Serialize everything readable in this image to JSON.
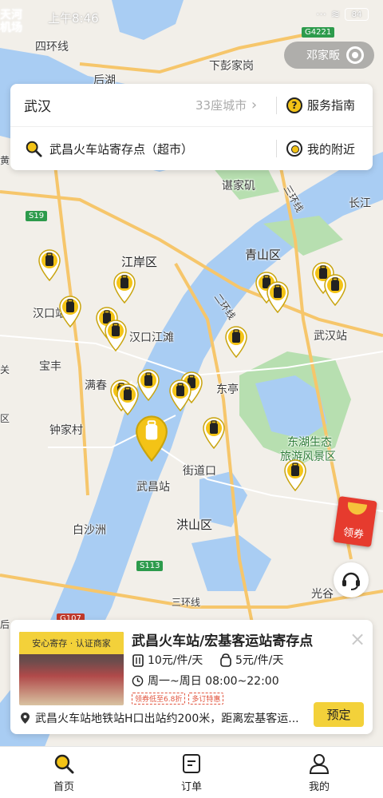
{
  "status_bar": {
    "time": "上午8:46",
    "battery": "84",
    "signal": "⋯",
    "wifi": "≋"
  },
  "map_overlay": {
    "user_chip_label": "邓家畈"
  },
  "search_card": {
    "city": "武汉",
    "city_count": "33座城市",
    "guide_label": "服务指南",
    "search_text": "武昌火车站寄存点（超市）",
    "nearby_label": "我的附近"
  },
  "map_labels": {
    "tianhe": "天河",
    "jichang": "机场",
    "sihuanxian": "四环线",
    "houhu": "后湖",
    "xiapeng": "下彭家岗",
    "xieji": "谌家矶",
    "sanhuanxian": "三环线",
    "changjiang": "长江",
    "jianganqu": "江岸区",
    "qingshanqu": "青山区",
    "hankouzhan": "汉口站",
    "hankoujiangtan": "汉口江滩",
    "erhuanxian": "二环线",
    "wuhanzhan": "武汉站",
    "baofeng": "宝丰",
    "manchun": "满春",
    "dongting": "东亭",
    "zhongjiacun": "钟家村",
    "changjiang2": "长江",
    "wuchangzhan": "武昌站",
    "jiedaokou": "街道口",
    "donghu": "东湖生态",
    "lvyou": "旅游风景区",
    "baishazhou": "白沙洲",
    "hongshanqu": "洪山区",
    "sanhuanxian2": "三环线",
    "guanggu": "光谷",
    "yan": "黄",
    "guan": "关",
    "qu": "区",
    "hou": "后",
    "s19": "S19",
    "g4221": "G4221",
    "s113": "S113",
    "g107": "G107"
  },
  "coupon_label": "领券",
  "info_card": {
    "badge": "安心寄存 · 认证商家",
    "title": "武昌火车站/宏基客运站寄存点",
    "price_big": "10元/件/天",
    "price_small": "5元/件/天",
    "hours": "周一~周日 08:00~22:00",
    "tag1": "领券低至6.8折",
    "tag2": "多订特惠",
    "address": "武昌火车站地铁站H口出站约200米，距离宏基客运...",
    "book_label": "预定",
    "close_label": "×"
  },
  "tabbar": {
    "home": "首页",
    "orders": "订单",
    "mine": "我的"
  },
  "colors": {
    "accent": "#f3c316",
    "water": "#a9cdf3",
    "park": "#b7dfb0"
  },
  "icons": [
    "search-icon",
    "question-icon",
    "target-icon",
    "luggage-pin-icon",
    "headset-icon",
    "close-icon",
    "location-icon",
    "orders-icon",
    "user-icon"
  ]
}
